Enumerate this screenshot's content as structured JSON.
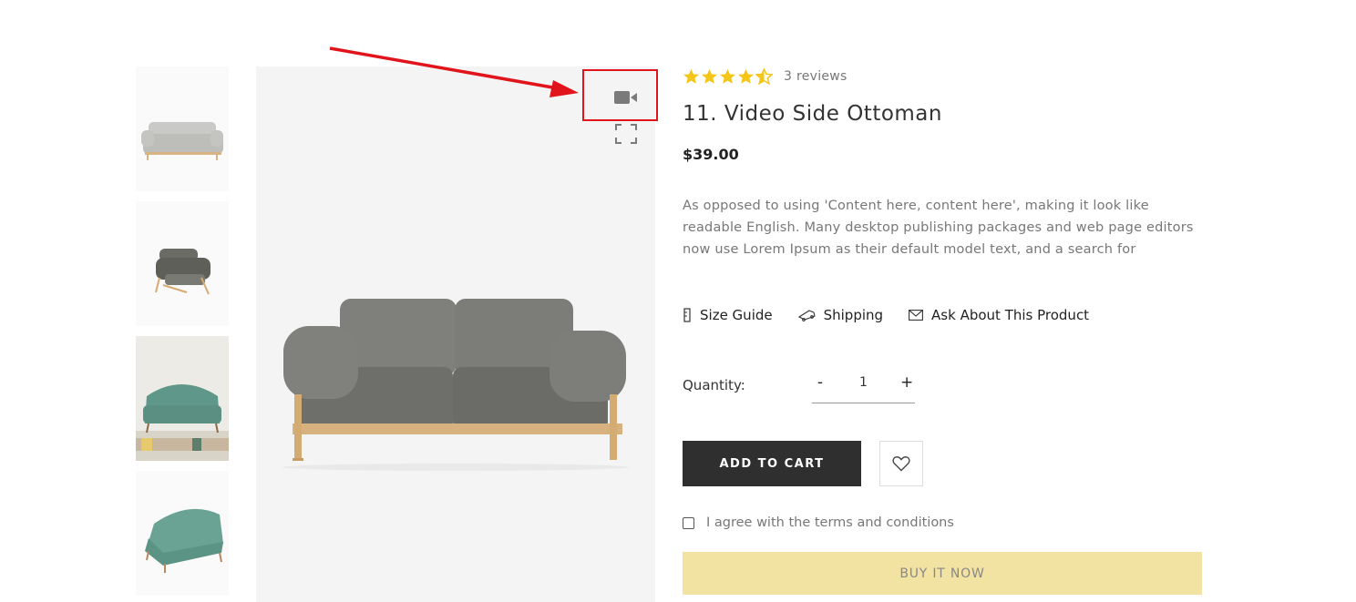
{
  "thumbnails": [
    {
      "alt": "grey sofa front view"
    },
    {
      "alt": "grey sofa side view"
    },
    {
      "alt": "teal sofa in room"
    },
    {
      "alt": "teal sofa angled"
    }
  ],
  "product": {
    "rating": 4.5,
    "reviews": "3 reviews",
    "title": "11. Video Side Ottoman",
    "price": "$39.00",
    "description": "As opposed to using 'Content here, content here', making it look like readable English. Many desktop publishing packages and web page editors now use Lorem Ipsum as their default model text, and a search for"
  },
  "links": {
    "size_guide": "Size Guide",
    "shipping": "Shipping",
    "ask": "Ask About This Product"
  },
  "quantity": {
    "label": "Quantity:",
    "minus": "-",
    "value": "1",
    "plus": "+"
  },
  "buttons": {
    "add_to_cart": "ADD TO CART",
    "buy_now": "BUY IT NOW"
  },
  "terms": {
    "label": "I agree with the terms and conditions"
  },
  "icons": {
    "video": "video-camera-icon",
    "fullscreen": "expand-icon",
    "wishlist": "heart-icon",
    "size_guide": "ruler-icon",
    "shipping": "truck-icon",
    "ask": "envelope-icon"
  },
  "colors": {
    "star": "#f5c518",
    "add_to_cart_bg": "#2f2f2f",
    "buy_now_bg": "#f3e3a2",
    "annotation": "#e0141a"
  }
}
